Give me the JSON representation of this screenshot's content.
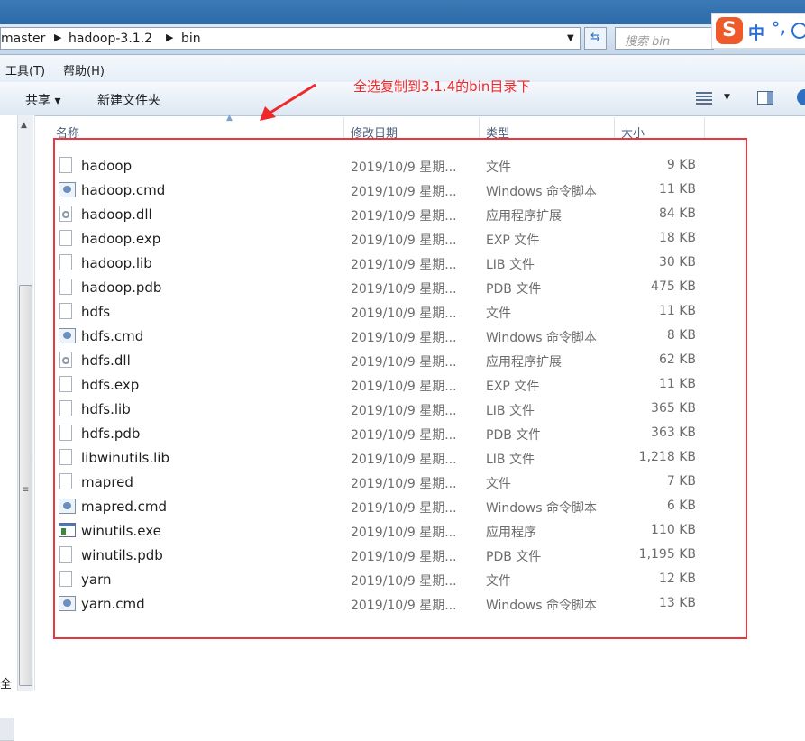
{
  "address_bar": {
    "breadcrumbs": [
      "master",
      "hadoop-3.1.2",
      "bin"
    ],
    "search_placeholder": "搜索 bin"
  },
  "ime": {
    "logo": "S",
    "mode": "中",
    "punct": "°,"
  },
  "menu": {
    "tools": "工具(T)",
    "help": "帮助(H)"
  },
  "toolbar": {
    "share": "共享 ▾",
    "new_folder": "新建文件夹"
  },
  "annotation": {
    "text": "全选复制到3.1.4的bin目录下",
    "color": "#f02828"
  },
  "columns": {
    "name": "名称",
    "date": "修改日期",
    "type": "类型",
    "size": "大小"
  },
  "nav_fragment": "全",
  "files": [
    {
      "name": "hadoop",
      "date": "2019/10/9 星期...",
      "type": "文件",
      "size": "9 KB",
      "icon": "file-icon"
    },
    {
      "name": "hadoop.cmd",
      "date": "2019/10/9 星期...",
      "type": "Windows 命令脚本",
      "size": "11 KB",
      "icon": "cmd-icon"
    },
    {
      "name": "hadoop.dll",
      "date": "2019/10/9 星期...",
      "type": "应用程序扩展",
      "size": "84 KB",
      "icon": "dll-icon"
    },
    {
      "name": "hadoop.exp",
      "date": "2019/10/9 星期...",
      "type": "EXP 文件",
      "size": "18 KB",
      "icon": "file-icon"
    },
    {
      "name": "hadoop.lib",
      "date": "2019/10/9 星期...",
      "type": "LIB 文件",
      "size": "30 KB",
      "icon": "file-icon"
    },
    {
      "name": "hadoop.pdb",
      "date": "2019/10/9 星期...",
      "type": "PDB 文件",
      "size": "475 KB",
      "icon": "file-icon"
    },
    {
      "name": "hdfs",
      "date": "2019/10/9 星期...",
      "type": "文件",
      "size": "11 KB",
      "icon": "file-icon"
    },
    {
      "name": "hdfs.cmd",
      "date": "2019/10/9 星期...",
      "type": "Windows 命令脚本",
      "size": "8 KB",
      "icon": "cmd-icon"
    },
    {
      "name": "hdfs.dll",
      "date": "2019/10/9 星期...",
      "type": "应用程序扩展",
      "size": "62 KB",
      "icon": "dll-icon"
    },
    {
      "name": "hdfs.exp",
      "date": "2019/10/9 星期...",
      "type": "EXP 文件",
      "size": "11 KB",
      "icon": "file-icon"
    },
    {
      "name": "hdfs.lib",
      "date": "2019/10/9 星期...",
      "type": "LIB 文件",
      "size": "365 KB",
      "icon": "file-icon"
    },
    {
      "name": "hdfs.pdb",
      "date": "2019/10/9 星期...",
      "type": "PDB 文件",
      "size": "363 KB",
      "icon": "file-icon"
    },
    {
      "name": "libwinutils.lib",
      "date": "2019/10/9 星期...",
      "type": "LIB 文件",
      "size": "1,218 KB",
      "icon": "file-icon"
    },
    {
      "name": "mapred",
      "date": "2019/10/9 星期...",
      "type": "文件",
      "size": "7 KB",
      "icon": "file-icon"
    },
    {
      "name": "mapred.cmd",
      "date": "2019/10/9 星期...",
      "type": "Windows 命令脚本",
      "size": "6 KB",
      "icon": "cmd-icon"
    },
    {
      "name": "winutils.exe",
      "date": "2019/10/9 星期...",
      "type": "应用程序",
      "size": "110 KB",
      "icon": "exe-icon"
    },
    {
      "name": "winutils.pdb",
      "date": "2019/10/9 星期...",
      "type": "PDB 文件",
      "size": "1,195 KB",
      "icon": "file-icon"
    },
    {
      "name": "yarn",
      "date": "2019/10/9 星期...",
      "type": "文件",
      "size": "12 KB",
      "icon": "file-icon"
    },
    {
      "name": "yarn.cmd",
      "date": "2019/10/9 星期...",
      "type": "Windows 命令脚本",
      "size": "13 KB",
      "icon": "cmd-icon"
    }
  ]
}
